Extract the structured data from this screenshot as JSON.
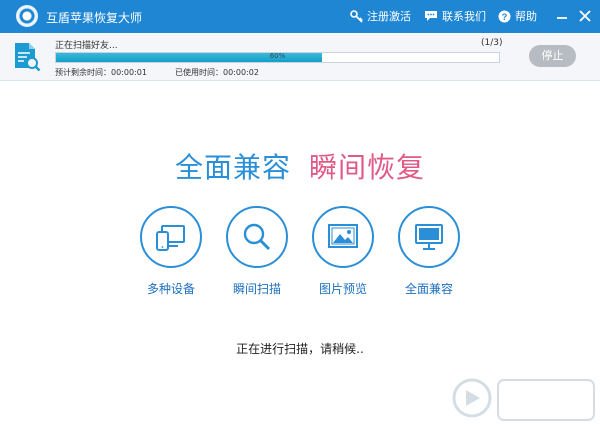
{
  "titlebar": {
    "app_title": "互盾苹果恢复大师",
    "register_label": "注册激活",
    "contact_label": "联系我们",
    "help_label": "帮助"
  },
  "progress": {
    "status": "正在扫描好友...",
    "count": "(1/3)",
    "percent": 60,
    "bar_text": "60%",
    "time_left": "预计剩余时间：00:00:01",
    "time_used": "已使用时间：00:00:02",
    "stop_label": "停止"
  },
  "main": {
    "slogan_a": "全面兼容",
    "slogan_b": "瞬间恢复",
    "features": [
      {
        "label": "多种设备",
        "icon": "devices-icon"
      },
      {
        "label": "瞬间扫描",
        "icon": "magnifier-icon"
      },
      {
        "label": "图片预览",
        "icon": "picture-icon"
      },
      {
        "label": "全面兼容",
        "icon": "monitor-icon"
      }
    ],
    "scan_text": "正在进行扫描，请稍候.."
  },
  "colors": {
    "titlebar": "#1f86d3",
    "accent_blue": "#2b8fd8",
    "accent_pink": "#e05a86",
    "progress_fill": "#1aa6cf",
    "stop_button": "#b7bcc2"
  }
}
